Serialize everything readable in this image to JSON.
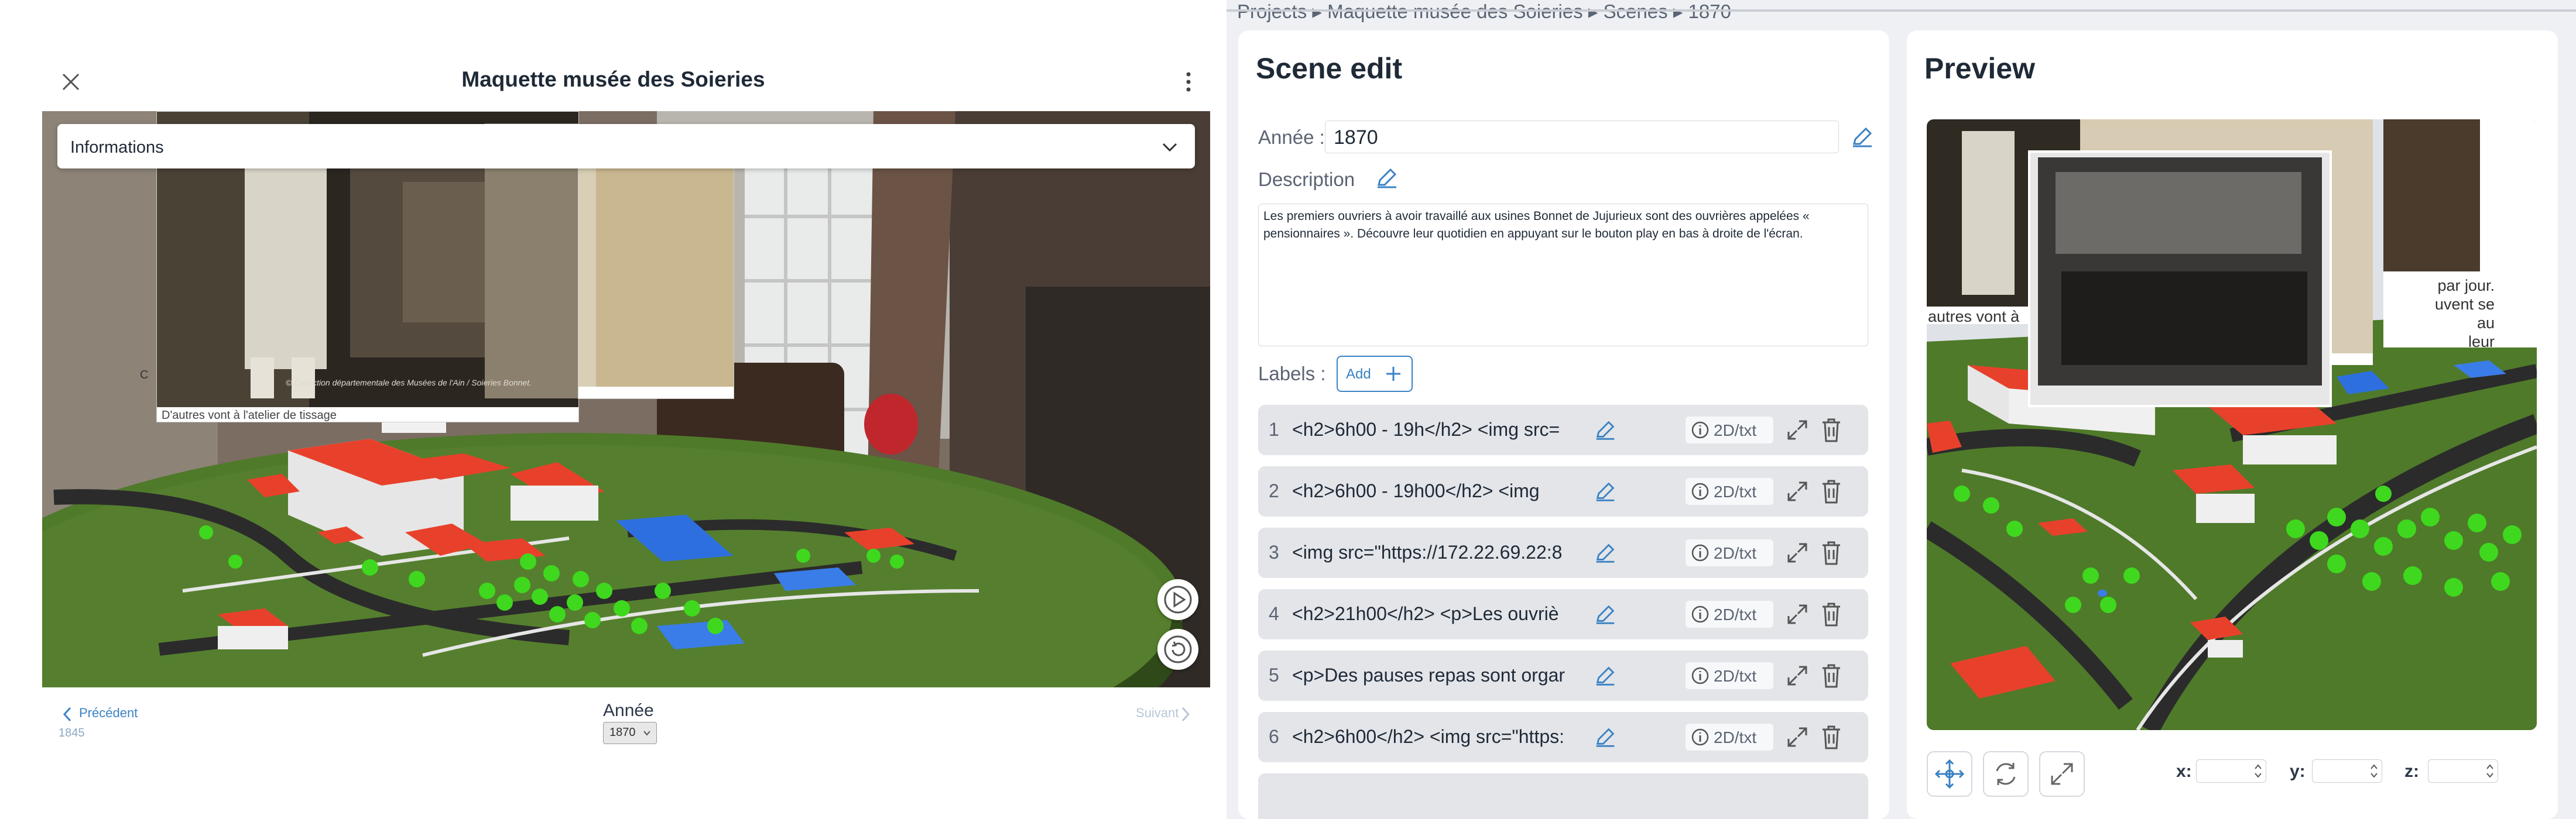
{
  "left": {
    "title": "Maquette musée des Soieries",
    "info_label": "Informations",
    "photo_caption": "D'autres vont à l'atelier de tissage",
    "photo_credit": "© Collection départementale des Musées de l'Ain / Soieries Bonnet.",
    "side_letter": "C",
    "footer": {
      "prev_label": "Précédent",
      "prev_year": "1845",
      "year_label": "Année",
      "year_value": "1870",
      "next_label": "Suivant"
    }
  },
  "right": {
    "breadcrumb": "Projects ▸ Maquette musée des Soieries ▸ Scenes ▸ 1870",
    "scene_title": "Scene edit",
    "year_label": "Année :",
    "year_value": "1870",
    "description_label": "Description",
    "description_text": "Les premiers ouvriers à avoir travaillé aux usines Bonnet de Jujurieux sont des ouvrières appelées « pensionnaires ». Découvre leur quotidien en appuyant sur le bouton play en bas à droite de l'écran.",
    "labels_label": "Labels :",
    "add_label": "Add",
    "labels": [
      {
        "num": "1",
        "text": "<h2>6h00 - 19h</h2> <img src=",
        "type": "2D/txt"
      },
      {
        "num": "2",
        "text": "<h2>6h00 - 19h00</h2>     <img",
        "type": "2D/txt"
      },
      {
        "num": "3",
        "text": "<img src=\"https://172.22.69.22:8",
        "type": "2D/txt"
      },
      {
        "num": "4",
        "text": "<h2>21h00</h2> <p>Les ouvriè",
        "type": "2D/txt"
      },
      {
        "num": "5",
        "text": "<p>Des pauses repas sont orgar",
        "type": "2D/txt"
      },
      {
        "num": "6",
        "text": "<h2>6h00</h2> <img src=\"https:",
        "type": "2D/txt"
      }
    ],
    "preview_title": "Preview",
    "preview_captions": {
      "left": "autres vont à",
      "right_lines": [
        "par jour.",
        "uvent se",
        "au",
        "leur"
      ]
    },
    "coords": {
      "x_label": "x:",
      "y_label": "y:",
      "z_label": "z:"
    }
  },
  "colors": {
    "accent": "#3b82c4",
    "roof": "#e8412b",
    "grass": "#4f7a2a",
    "tree": "#3fd81e"
  }
}
